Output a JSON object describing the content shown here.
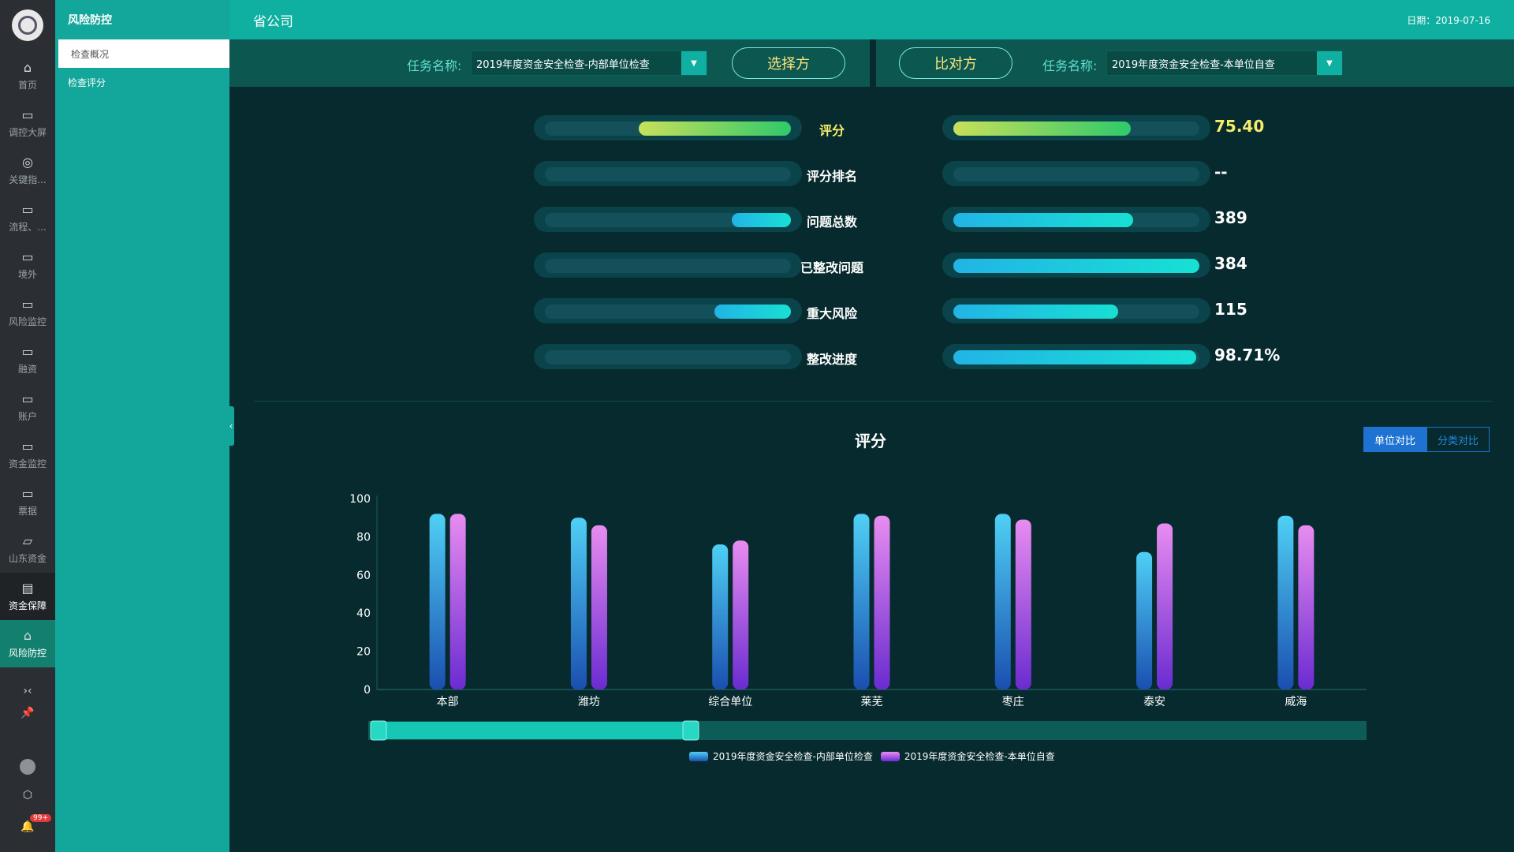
{
  "rail": {
    "items": [
      {
        "label": "首页",
        "icon": "home-icon"
      },
      {
        "label": "调控大屏",
        "icon": "folder-icon"
      },
      {
        "label": "关键指...",
        "icon": "dashboard-icon"
      },
      {
        "label": "流程、...",
        "icon": "folder-icon"
      },
      {
        "label": "境外",
        "icon": "folder-icon"
      },
      {
        "label": "风险监控",
        "icon": "folder-icon"
      },
      {
        "label": "融资",
        "icon": "folder-icon"
      },
      {
        "label": "账户",
        "icon": "folder-icon"
      },
      {
        "label": "资金监控",
        "icon": "folder-icon"
      },
      {
        "label": "票据",
        "icon": "folder-icon"
      },
      {
        "label": "山东资金",
        "icon": "folder-open-icon"
      },
      {
        "label": "资金保障",
        "icon": "card-icon"
      },
      {
        "label": "风险防控",
        "icon": "home-icon"
      }
    ],
    "notification_count": "99+"
  },
  "submenu": {
    "title": "风险防控",
    "items": [
      "检查概况",
      "检查评分"
    ]
  },
  "header": {
    "title": "省公司",
    "date_label": "日期：",
    "date": "2019-07-16"
  },
  "selector": {
    "left_label": "任务名称:",
    "left_value": "2019年度资金安全检查-内部单位检查",
    "left_button": "选择方",
    "right_button": "比对方",
    "right_label": "任务名称:",
    "right_value": "2019年度资金安全检查-本单位自查"
  },
  "metrics": [
    {
      "label": "评分",
      "left": "63.20",
      "right": "75.40",
      "left_frac": 0.62,
      "right_frac": 0.72,
      "style": "score"
    },
    {
      "label": "评分排名",
      "left": "--",
      "right": "--",
      "left_frac": 0,
      "right_frac": 0,
      "style": "cyan"
    },
    {
      "label": "问题总数",
      "left": "132",
      "right": "389",
      "left_frac": 0.24,
      "right_frac": 0.73,
      "style": "cyan"
    },
    {
      "label": "已整改问题",
      "left": "0",
      "right": "384",
      "left_frac": 0,
      "right_frac": 1.0,
      "style": "cyan"
    },
    {
      "label": "重大风险",
      "left": "54",
      "right": "115",
      "left_frac": 0.31,
      "right_frac": 0.67,
      "style": "cyan"
    },
    {
      "label": "整改进度",
      "left": "0.00%",
      "right": "98.71%",
      "left_frac": 0,
      "right_frac": 0.9871,
      "style": "cyan"
    }
  ],
  "chart_toggle": {
    "on": "单位对比",
    "off": "分类对比"
  },
  "chart_data": {
    "type": "bar",
    "title": "评分",
    "categories": [
      "本部",
      "潍坊",
      "综合单位",
      "莱芜",
      "枣庄",
      "泰安",
      "威海"
    ],
    "ylim": [
      0,
      100
    ],
    "yticks": [
      0,
      20,
      40,
      60,
      80,
      100
    ],
    "series": [
      {
        "name": "2019年度资金安全检查-内部单位检查",
        "values": [
          92,
          90,
          76,
          92,
          92,
          72,
          91
        ]
      },
      {
        "name": "2019年度资金安全检查-本单位自查",
        "values": [
          92,
          86,
          78,
          91,
          89,
          87,
          86
        ]
      }
    ],
    "legend_position": "bottom",
    "colors": {
      "series0_top": "#4fd0f5",
      "series0_bottom": "#1a4fb0",
      "series1_top": "#e88cf0",
      "series1_bottom": "#6a2bd0"
    }
  }
}
